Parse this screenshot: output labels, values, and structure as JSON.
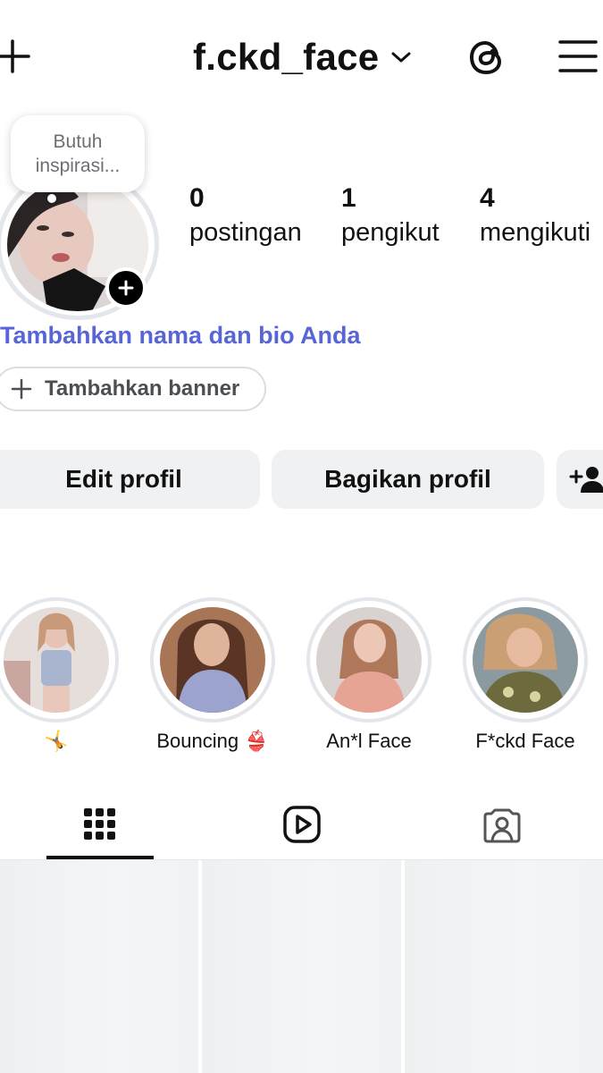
{
  "header": {
    "username": "f.ckd_face",
    "icons": [
      "plus-icon",
      "chevron-down-icon",
      "threads-icon",
      "hamburger-menu-icon"
    ]
  },
  "profile": {
    "tooltip": "Butuh inspirasi...",
    "stats": [
      {
        "value": "0",
        "label": "postingan"
      },
      {
        "value": "1",
        "label": "pengikut"
      },
      {
        "value": "4",
        "label": "mengikuti"
      }
    ],
    "bio_prompt": "Tambahkan nama dan bio Anda",
    "banner_button": "Tambahkan banner"
  },
  "actions": {
    "edit": "Edit profil",
    "share": "Bagikan profil",
    "add_user_icon": "add-person-icon"
  },
  "highlights": [
    {
      "label": "🤸"
    },
    {
      "label": "Bouncing 👙"
    },
    {
      "label": "An*l Face"
    },
    {
      "label": "F*ckd Face"
    }
  ],
  "tabs": [
    {
      "icon": "grid-icon",
      "active": true
    },
    {
      "icon": "reels-icon",
      "active": false
    },
    {
      "icon": "tagged-icon",
      "active": false
    }
  ],
  "colors": {
    "accent_link": "#5865d6",
    "button_bg": "#eff1f3",
    "ring": "#e3e6ea"
  }
}
